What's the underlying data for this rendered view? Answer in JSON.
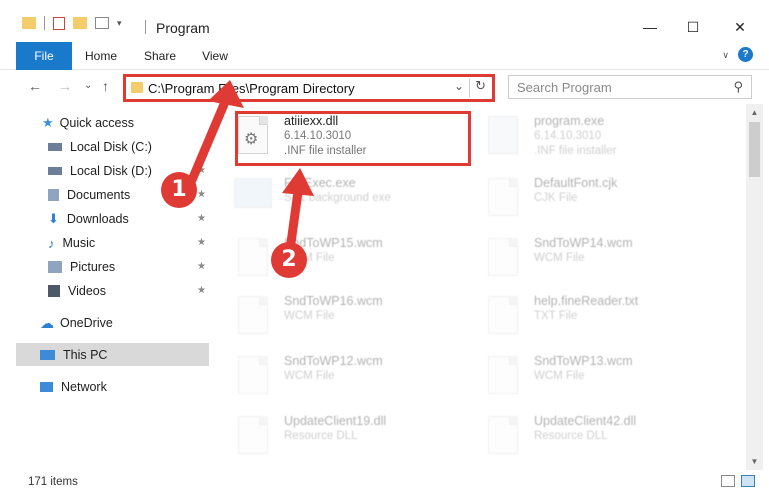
{
  "window": {
    "title": "Program",
    "minimize": "—",
    "maximize": "☐",
    "close": "✕"
  },
  "ribbon": {
    "tabs": [
      "File",
      "Home",
      "Share",
      "View"
    ]
  },
  "address": {
    "path": "C:\\Program Files\\Program Directory",
    "back": "←",
    "forward": "→",
    "recent": "⌄",
    "up": "↑",
    "chevron": "⌄",
    "refresh": "↻"
  },
  "search": {
    "placeholder": "Search Program",
    "icon": "search-icon"
  },
  "nav": {
    "items": [
      {
        "label": "Quick access",
        "icon": "star-icon",
        "color": "#3b8de0"
      },
      {
        "label": "Local Disk (C:)",
        "icon": "drive-icon",
        "color": "#6b7f99"
      },
      {
        "label": "Local Disk (D:)",
        "icon": "drive-icon",
        "color": "#6b7f99"
      },
      {
        "label": "Documents",
        "icon": "documents-icon",
        "color": "#8fa5bf"
      },
      {
        "label": "Downloads",
        "icon": "download-icon",
        "color": "#2f7fd3"
      },
      {
        "label": "Music",
        "icon": "music-icon",
        "color": "#2f7fd3"
      },
      {
        "label": "Pictures",
        "icon": "pictures-icon",
        "color": "#8fa5bf"
      },
      {
        "label": "Videos",
        "icon": "videos-icon",
        "color": "#4d5868"
      },
      {
        "label": "OneDrive",
        "icon": "cloud-icon",
        "color": "#2f7fd3"
      },
      {
        "label": "This PC",
        "icon": "computer-icon",
        "color": "#3c8ad8"
      },
      {
        "label": "Network",
        "icon": "network-icon",
        "color": "#3c8ad8"
      }
    ],
    "pin": "★"
  },
  "files": [
    {
      "name": "atiiiexx.dll",
      "meta": "6.14.10.3010",
      "meta2": ".INF file installer",
      "faded": false
    },
    {
      "name": "program.exe",
      "meta": "6.14.10.3010",
      "meta2": ".INF file installer",
      "faded": true
    },
    {
      "name": "FileExec.exe",
      "meta": "SP1 background exe",
      "meta2": "",
      "faded": true
    },
    {
      "name": "DefaultFont.cjk",
      "meta": "CJK File",
      "meta2": "",
      "faded": true
    },
    {
      "name": "SndToWP15.wcm",
      "meta": "WCM File",
      "meta2": "",
      "faded": true
    },
    {
      "name": "SndToWP14.wcm",
      "meta": "WCM File",
      "meta2": "",
      "faded": true
    },
    {
      "name": "SndToWP16.wcm",
      "meta": "WCM File",
      "meta2": "",
      "faded": true
    },
    {
      "name": "help.fineReader.txt",
      "meta": "TXT File",
      "meta2": "",
      "faded": true
    },
    {
      "name": "SndToWP12.wcm",
      "meta": "WCM File",
      "meta2": "",
      "faded": true
    },
    {
      "name": "SndToWP13.wcm",
      "meta": "WCM File",
      "meta2": "",
      "faded": true
    },
    {
      "name": "UpdateClient19.dll",
      "meta": "Resource DLL",
      "meta2": "",
      "faded": true
    },
    {
      "name": "UpdateClient42.dll",
      "meta": "Resource DLL",
      "meta2": "",
      "faded": true
    }
  ],
  "status": {
    "count": "171 items"
  },
  "callouts": [
    "1",
    "2"
  ],
  "colors": {
    "accent": "#1979ca",
    "highlight": "#e03a35"
  }
}
